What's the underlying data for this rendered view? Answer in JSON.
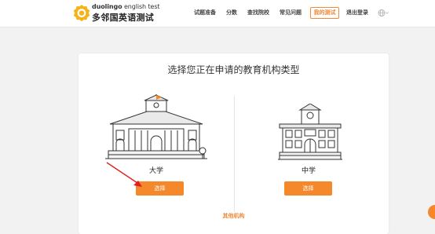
{
  "header": {
    "logo_en_bold": "duolingo",
    "logo_en_rest": " english test",
    "logo_cn": "多邻国英语测试",
    "nav": [
      "试题准备",
      "分数",
      "查找院校",
      "常见问题"
    ],
    "active_nav": "我的测试",
    "logout": "退出登录",
    "language_icon": "globe-icon"
  },
  "main": {
    "title": "选择您正在申请的教育机构类型",
    "options": [
      {
        "label": "大学",
        "button": "选择",
        "icon": "university-building-icon"
      },
      {
        "label": "中学",
        "button": "选择",
        "icon": "school-building-icon"
      }
    ],
    "other_link": "其他机构"
  },
  "colors": {
    "accent": "#f5882a",
    "background": "#f2f2f2",
    "arrow": "#e02020"
  }
}
